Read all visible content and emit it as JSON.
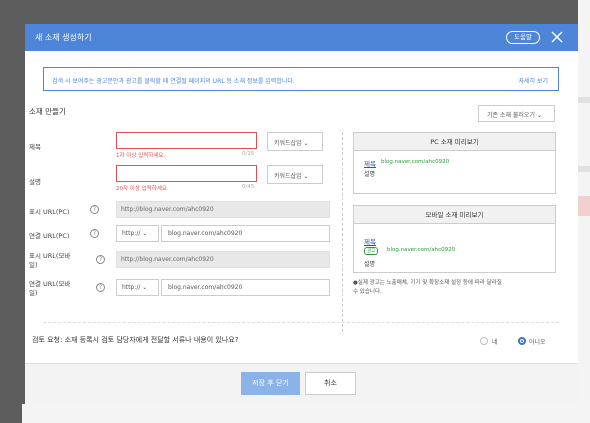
{
  "colors": {
    "accent": "#4d86d9",
    "error": "#e05050",
    "url_green": "#2a9a3a",
    "link_blue": "#2a55b0",
    "overlay": "#5d5d5d"
  },
  "modal": {
    "title": "새 소재 생성하기",
    "guide_button": "도움말",
    "close_icon": "close-icon",
    "notice_text": "검색 시 보여주는 광고문안과 광고를 클릭할 때 연결될 페이지의 URL 등 소재 정보를 입력합니다.",
    "notice_link": "자세히 보기",
    "section_title": "소재 만들기",
    "load_dropdown": "기존 소재 불러오기 ⌄"
  },
  "form": {
    "title_label": "제목",
    "title_value": "",
    "title_error": "1자 이상 입력하세요.",
    "title_counter": "0/15",
    "desc_label": "설명",
    "desc_value": "",
    "desc_error": "20자 이상 입력하세요.",
    "desc_counter": "0/45",
    "keyword_insert": "키워드삽입 ⌄",
    "display_url_pc_label": "표시 URL(PC)",
    "display_url_pc_value": "http://blog.naver.com/ahc0920",
    "link_url_pc_label": "연결 URL(PC)",
    "link_url_pc_protocol": "http:// ⌄",
    "link_url_pc_value": "blog.naver.com/ahc0920",
    "display_url_mobile_label_1": "표시 URL(모바",
    "display_url_mobile_label_2": "일)",
    "display_url_mobile_value": "http://blog.naver.com/ahc0920",
    "link_url_mobile_label_1": "연결 URL(모바",
    "link_url_mobile_label_2": "일)",
    "link_url_mobile_protocol": "http:// ⌄",
    "link_url_mobile_value": "blog.naver.com/ahc0920",
    "help_icon": "help-icon"
  },
  "preview": {
    "pc_head": "PC 소재 미리보기",
    "pc_title": "제목",
    "pc_url": "blog.naver.com/ahc0920",
    "pc_desc": "설명",
    "mobile_head": "모바일 소재 미리보기",
    "mobile_title": "제목",
    "mobile_badge": "광고",
    "mobile_url": "blog.naver.com/ahc0920",
    "mobile_desc": "설명",
    "note_line1": "●실제 광고는 노출매체, 기기 및 확장소재 설정 등에 따라 달라질",
    "note_line2": "수 있습니다."
  },
  "review": {
    "question": "검토 요청: 소재 등록시 검토 담당자에게 전달할 서류나 내용이 있나요?",
    "yes": "네",
    "no": "아니오",
    "selected": "no"
  },
  "footer": {
    "next_button": "저장 후 닫기",
    "cancel_button": "취소"
  }
}
